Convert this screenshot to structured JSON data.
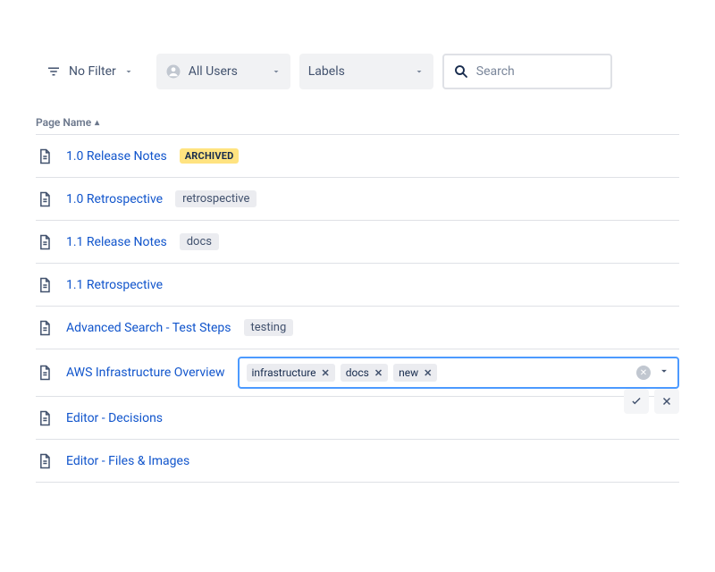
{
  "filters": {
    "no_filter_label": "No Filter",
    "users_label": "All Users",
    "labels_label": "Labels",
    "search_placeholder": "Search"
  },
  "table": {
    "header": "Page Name",
    "rows": [
      {
        "title": "1.0 Release Notes",
        "archived": true,
        "archived_label": "ARCHIVED",
        "labels": []
      },
      {
        "title": "1.0 Retrospective",
        "labels": [
          "retrospective"
        ]
      },
      {
        "title": "1.1 Release Notes",
        "labels": [
          "docs"
        ]
      },
      {
        "title": "1.1 Retrospective",
        "labels": []
      },
      {
        "title": "Advanced Search - Test Steps",
        "labels": [
          "testing"
        ]
      },
      {
        "title": "AWS Infrastructure Overview",
        "editing": true,
        "editing_tags": [
          "infrastructure",
          "docs",
          "new"
        ]
      },
      {
        "title": "Editor - Decisions",
        "labels": []
      },
      {
        "title": "Editor - Files & Images",
        "labels": []
      }
    ]
  }
}
